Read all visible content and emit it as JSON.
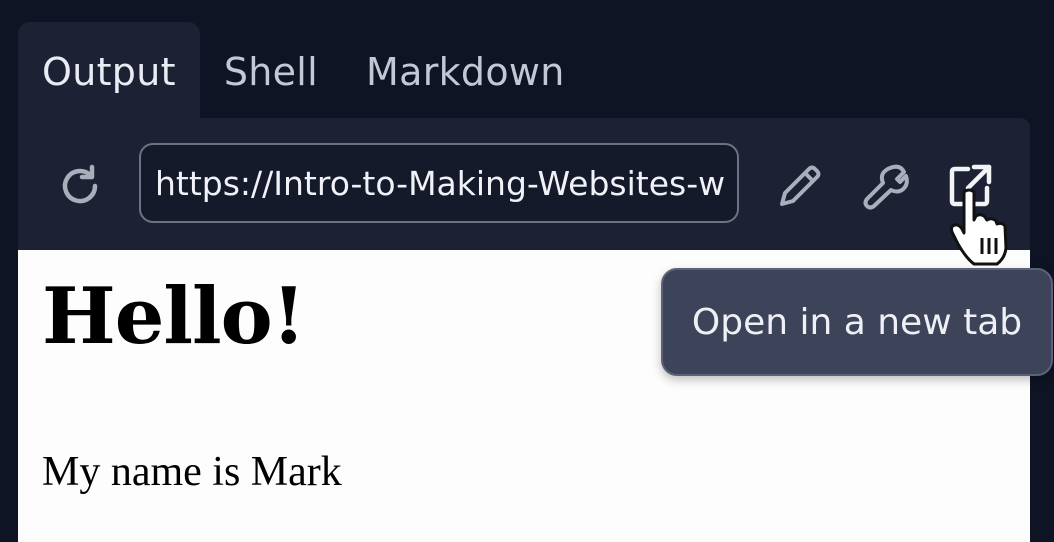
{
  "tabs": [
    {
      "label": "Output",
      "active": true
    },
    {
      "label": "Shell",
      "active": false
    },
    {
      "label": "Markdown",
      "active": false
    }
  ],
  "toolbar": {
    "url_value": "https://Intro-to-Making-Websites-w",
    "icons": [
      "reload-icon",
      "pencil-icon",
      "wrench-icon",
      "open-in-new-tab-icon"
    ]
  },
  "preview": {
    "heading": "Hello!",
    "paragraph": "My name is Mark"
  },
  "tooltip": {
    "text": "Open in a new tab"
  },
  "colors": {
    "background": "#0f1424",
    "panel": "#1c2133",
    "tooltip": "#3d4358",
    "icon": "#a9aebb"
  }
}
